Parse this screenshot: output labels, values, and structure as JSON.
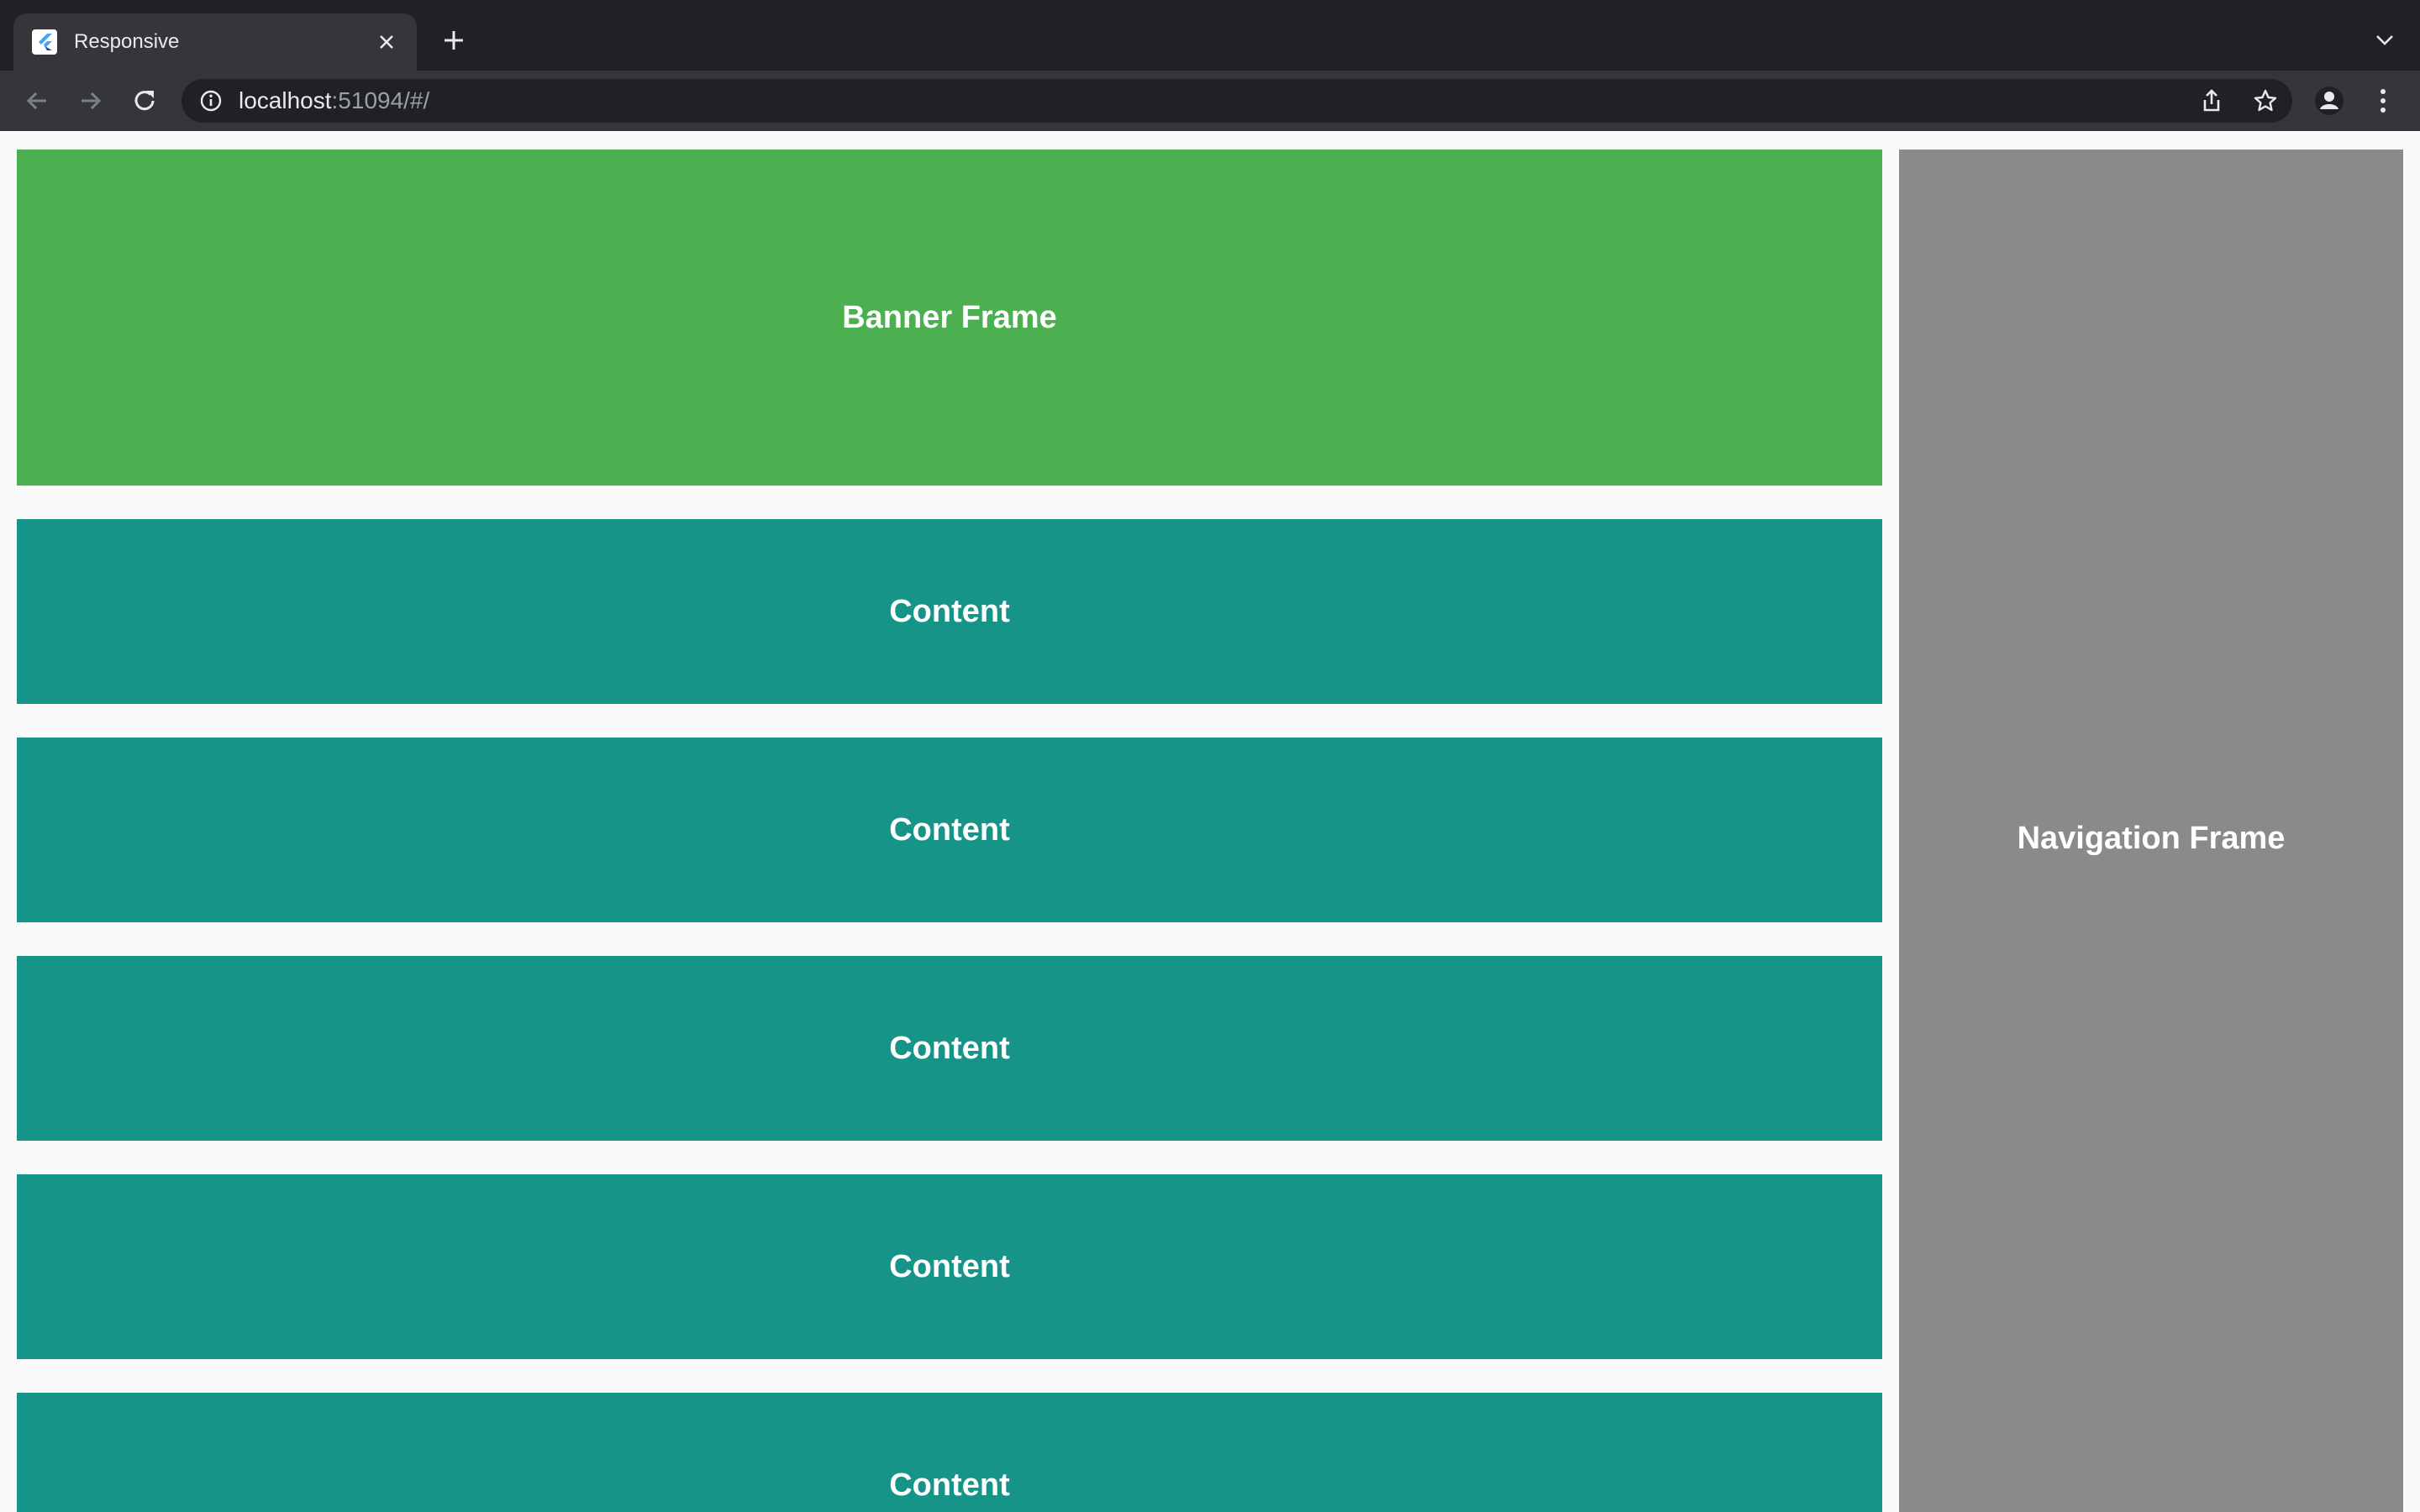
{
  "browser": {
    "tab": {
      "title": "Responsive",
      "favicon": "flutter-icon",
      "close_icon": "close-icon"
    },
    "new_tab_icon": "plus-icon",
    "tab_list_icon": "chevron-down-icon",
    "toolbar": {
      "back_icon": "arrow-left-icon",
      "forward_icon": "arrow-right-icon",
      "reload_icon": "reload-icon",
      "site_info_icon": "info-icon",
      "url_host": "localhost",
      "url_rest": ":51094/#/",
      "share_icon": "share-icon",
      "bookmark_icon": "star-icon",
      "profile_icon": "avatar-icon",
      "menu_icon": "kebab-menu-icon"
    }
  },
  "page": {
    "banner": {
      "label": "Banner Frame",
      "color": "#4caf50"
    },
    "navigation": {
      "label": "Navigation Frame",
      "color": "#8a8a8a"
    },
    "content_color": "#169488",
    "content_items": [
      {
        "label": "Content"
      },
      {
        "label": "Content"
      },
      {
        "label": "Content"
      },
      {
        "label": "Content"
      },
      {
        "label": "Content"
      }
    ]
  }
}
